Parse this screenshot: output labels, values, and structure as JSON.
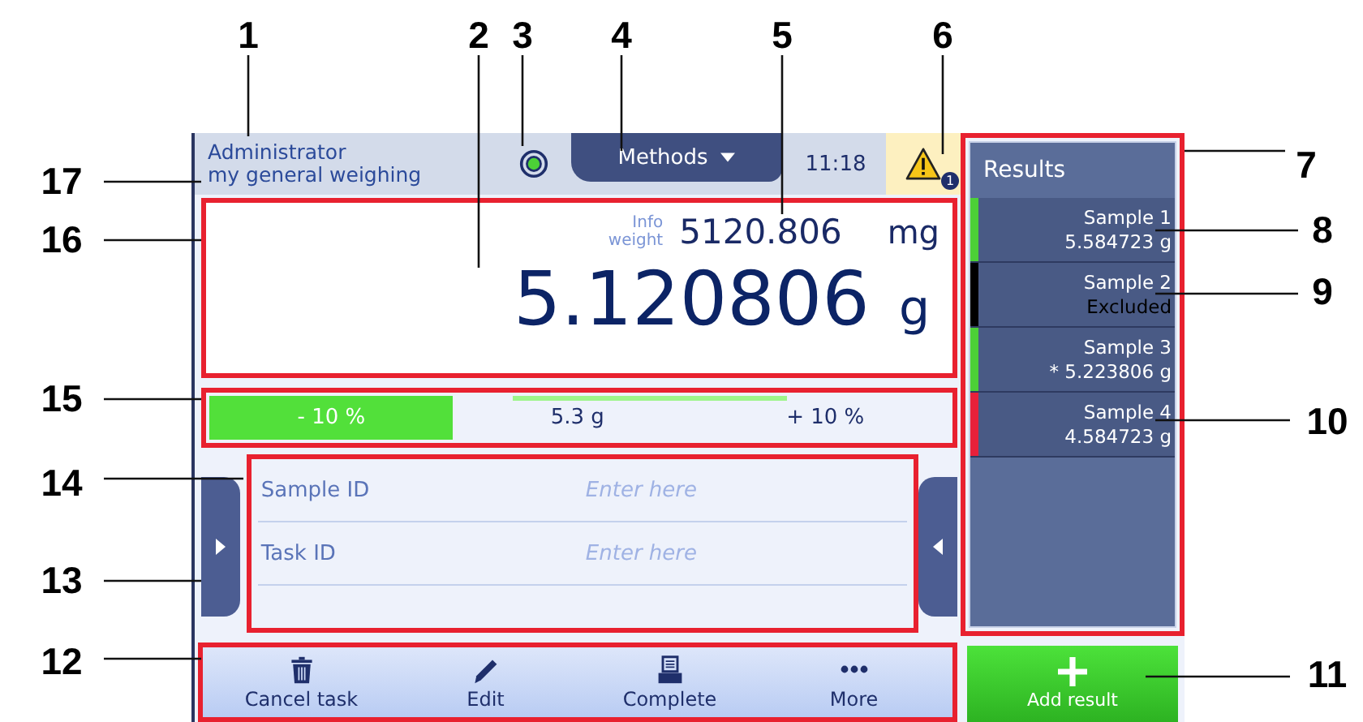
{
  "header": {
    "user": "Administrator",
    "method": "my general weighing",
    "methods_tab": "Methods",
    "time": "11:18",
    "warning_count": "1"
  },
  "weight": {
    "info_label": "Info weight",
    "info_value": "5120.806",
    "info_unit": "mg",
    "value": "5.120806",
    "unit": "g"
  },
  "tolerance_bar": {
    "level": 0.33,
    "labels": [
      "- 10 %",
      "5.3 g",
      "+ 10 %"
    ]
  },
  "fields": [
    {
      "label": "Sample ID",
      "placeholder": "Enter here"
    },
    {
      "label": "Task ID",
      "placeholder": "Enter here"
    }
  ],
  "toolbar": [
    {
      "kind": "trash",
      "label": "Cancel task"
    },
    {
      "kind": "pencil",
      "label": "Edit"
    },
    {
      "kind": "printer",
      "label": "Complete"
    },
    {
      "kind": "dots",
      "label": "More"
    }
  ],
  "results": {
    "title": "Results",
    "items": [
      {
        "name": "Sample 1",
        "value": "5.584723 g",
        "color": "#4cd137",
        "excluded": false
      },
      {
        "name": "Sample 2",
        "value": "Excluded",
        "color": "#000000",
        "excluded": true
      },
      {
        "name": "Sample 3",
        "value": "* 5.223806 g",
        "color": "#4cd137",
        "excluded": false
      },
      {
        "name": "Sample 4",
        "value": "4.584723 g",
        "color": "#e8213a",
        "excluded": false
      }
    ]
  },
  "add_button": "Add result",
  "callouts": [
    "1",
    "2",
    "3",
    "4",
    "5",
    "6",
    "7",
    "17",
    "8",
    "16",
    "9",
    "15",
    "10",
    "14",
    "13",
    "12",
    "11"
  ]
}
